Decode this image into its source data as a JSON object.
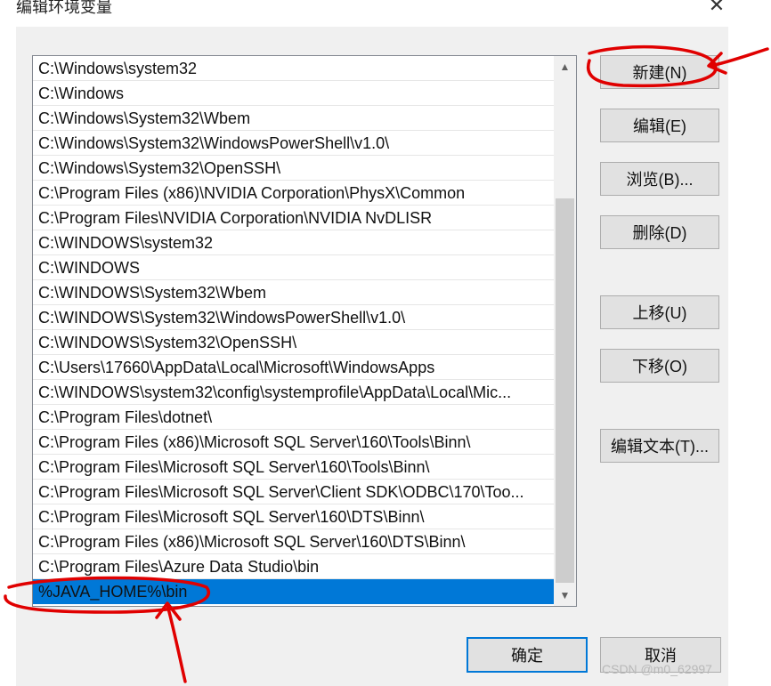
{
  "dialog": {
    "title": "编辑环境变量",
    "close_glyph": "✕"
  },
  "path_list": {
    "items": [
      "C:\\Windows\\system32",
      "C:\\Windows",
      "C:\\Windows\\System32\\Wbem",
      "C:\\Windows\\System32\\WindowsPowerShell\\v1.0\\",
      "C:\\Windows\\System32\\OpenSSH\\",
      "C:\\Program Files (x86)\\NVIDIA Corporation\\PhysX\\Common",
      "C:\\Program Files\\NVIDIA Corporation\\NVIDIA NvDLISR",
      "C:\\WINDOWS\\system32",
      "C:\\WINDOWS",
      "C:\\WINDOWS\\System32\\Wbem",
      "C:\\WINDOWS\\System32\\WindowsPowerShell\\v1.0\\",
      "C:\\WINDOWS\\System32\\OpenSSH\\",
      "C:\\Users\\17660\\AppData\\Local\\Microsoft\\WindowsApps",
      "C:\\WINDOWS\\system32\\config\\systemprofile\\AppData\\Local\\Mic...",
      "C:\\Program Files\\dotnet\\",
      "C:\\Program Files (x86)\\Microsoft SQL Server\\160\\Tools\\Binn\\",
      "C:\\Program Files\\Microsoft SQL Server\\160\\Tools\\Binn\\",
      "C:\\Program Files\\Microsoft SQL Server\\Client SDK\\ODBC\\170\\Too...",
      "C:\\Program Files\\Microsoft SQL Server\\160\\DTS\\Binn\\",
      "C:\\Program Files (x86)\\Microsoft SQL Server\\160\\DTS\\Binn\\",
      "C:\\Program Files\\Azure Data Studio\\bin",
      "%JAVA_HOME%\\bin"
    ],
    "selected_index": 21,
    "scroll_up_glyph": "▲",
    "scroll_down_glyph": "▼"
  },
  "buttons": {
    "new": "新建(N)",
    "edit": "编辑(E)",
    "browse": "浏览(B)...",
    "delete": "删除(D)",
    "move_up": "上移(U)",
    "move_down": "下移(O)",
    "edit_text": "编辑文本(T)...",
    "ok": "确定",
    "cancel": "取消"
  },
  "watermark": "CSDN @m0_62997",
  "colors": {
    "selection": "#0078d7",
    "annotation": "#e00000",
    "button_face": "#e1e1e1"
  }
}
